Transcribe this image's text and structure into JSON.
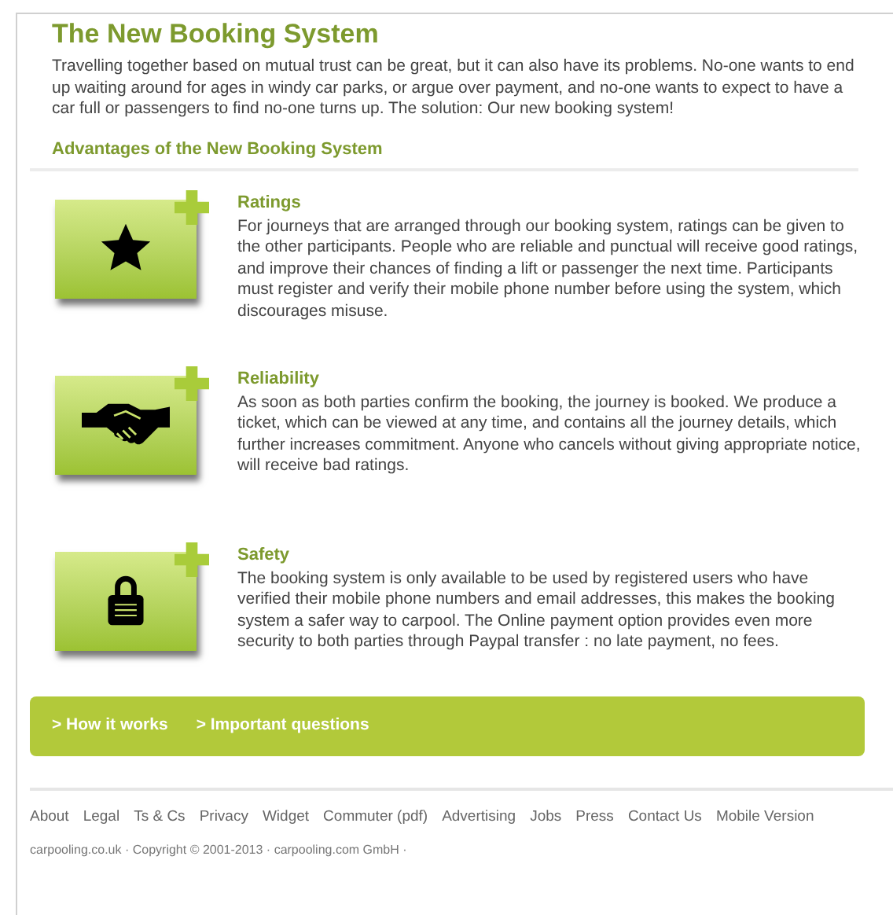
{
  "title": "The New Booking System",
  "intro": "Travelling together based on mutual trust can be great, but it can also have its problems. No-one wants to end up waiting around for ages in windy car parks, or argue over payment, and no-one wants to expect to have a car full or passengers to find no-one turns up. The solution: Our new booking system!",
  "section_heading": "Advantages of the New Booking System",
  "features": [
    {
      "kind": "star",
      "heading": "Ratings",
      "text": "For journeys that are arranged through our booking system, ratings can be given to the other participants. People who are reliable and punctual will receive good ratings, and improve their chances of finding a lift or passenger the next time. Participants must register and verify their mobile phone number before using the system, which discourages misuse."
    },
    {
      "kind": "handshake",
      "heading": "Reliability",
      "text": "As soon as both parties confirm the booking, the journey is booked. We produce a ticket, which can be viewed at any time, and contains all the journey details, which further increases commitment. Anyone who cancels without giving appropriate notice, will receive bad ratings."
    },
    {
      "kind": "lock",
      "heading": "Safety",
      "text": "The booking system is only available to be used by registered users who have verified their mobile phone numbers and email addresses, this makes the booking system a safer way to carpool. The Online payment option provides even more security to both parties through Paypal transfer : no late payment, no fees."
    }
  ],
  "links_bar": [
    "> How it works",
    "> Important questions"
  ],
  "footer_links": [
    "About",
    "Legal",
    "Ts & Cs",
    "Privacy",
    "Widget",
    "Commuter (pdf)",
    "Advertising",
    "Jobs",
    "Press",
    "Contact Us",
    "Mobile Version"
  ],
  "copyright": "carpooling.co.uk · Copyright © 2001-2013 · carpooling.com GmbH ·"
}
